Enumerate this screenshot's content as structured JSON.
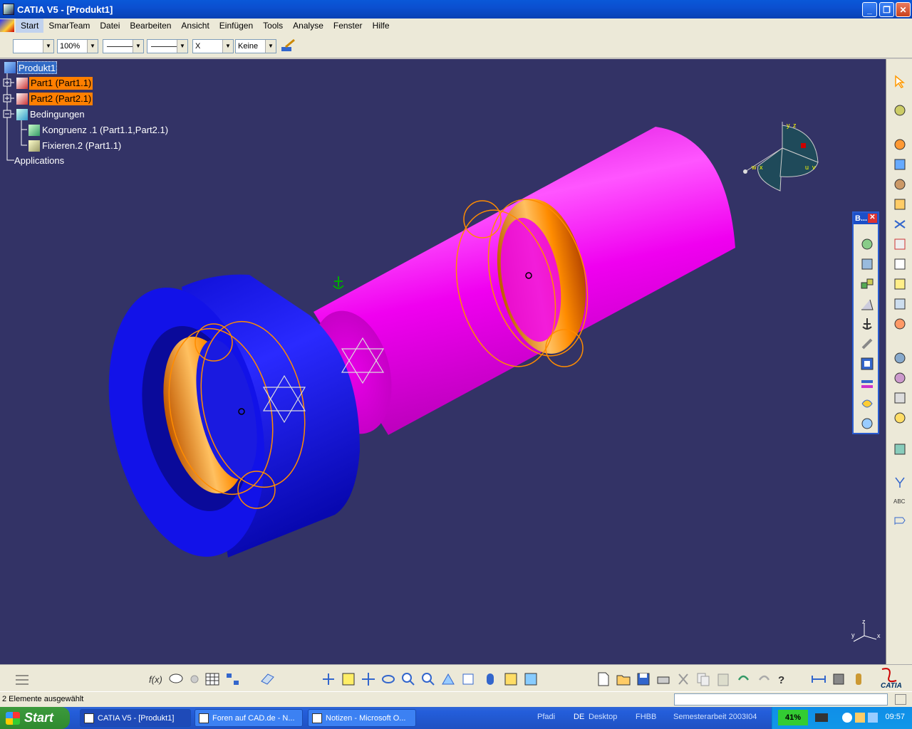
{
  "window": {
    "title": "CATIA V5 - [Produkt1]"
  },
  "menu": [
    "Start",
    "SmarTeam",
    "Datei",
    "Bearbeiten",
    "Ansicht",
    "Einfügen",
    "Tools",
    "Analyse",
    "Fenster",
    "Hilfe"
  ],
  "toolbar": {
    "zoom": "100%",
    "layer": "Keine",
    "pattern": "X"
  },
  "tree": {
    "root": "Produkt1",
    "part1": "Part1 (Part1.1)",
    "part2": "Part2 (Part2.1)",
    "constraints": "Bedingungen",
    "c1": "Kongruenz .1 (Part1.1,Part2.1)",
    "c2": "Fixieren.2 (Part1.1)",
    "apps": "Applications"
  },
  "compass": {
    "x": "x",
    "y": "y",
    "z": "z",
    "u": "u",
    "v": "v",
    "w": "w"
  },
  "axis_mini": {
    "x": "x",
    "y": "y",
    "z": "z"
  },
  "palette": {
    "title": "B..."
  },
  "status": {
    "text": "2 Elemente ausgewählt"
  },
  "taskbar": {
    "start": "Start",
    "tasks": [
      "CATIA V5 - [Produkt1]",
      "Foren auf CAD.de - N...",
      "Notizen - Microsoft O..."
    ],
    "quicklinks": [
      "Pfadi",
      "DE",
      "Desktop",
      "FHBB",
      "Semesterarbeit 2003I04"
    ],
    "battery": "41%",
    "clock": "09:57"
  },
  "colors": {
    "background": "#333366",
    "part1": "#1414f0",
    "part2": "#f000f0",
    "highlight": "#ff8c00"
  }
}
